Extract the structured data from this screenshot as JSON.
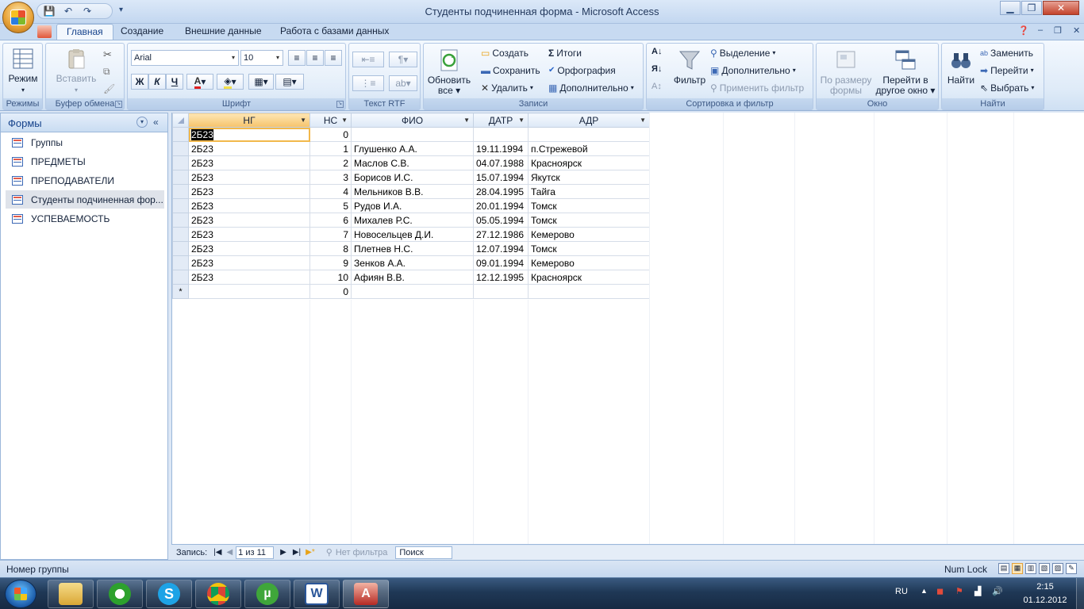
{
  "window": {
    "title": "Студенты подчиненная форма - Microsoft Access"
  },
  "tabs": [
    "Главная",
    "Создание",
    "Внешние данные",
    "Работа с базами данных"
  ],
  "ribbon": {
    "groups": [
      "Режимы",
      "Буфер обмена",
      "Шрифт",
      "Текст RTF",
      "Записи",
      "Сортировка и фильтр",
      "Окно",
      "Найти"
    ],
    "mode_label": "Режим",
    "paste_label": "Вставить",
    "font_name": "Arial",
    "font_size": "10",
    "bold": "Ж",
    "italic": "К",
    "underline": "Ч",
    "refresh_label_1": "Обновить",
    "refresh_label_2": "все",
    "records": {
      "create": "Создать",
      "save": "Сохранить",
      "delete": "Удалить",
      "totals": "Итоги",
      "spelling": "Орфография",
      "more": "Дополнительно"
    },
    "filter": {
      "filter": "Фильтр",
      "selection": "Выделение",
      "advanced": "Дополнительно",
      "apply": "Применить фильтр"
    },
    "window": {
      "fit_1": "По размеру",
      "fit_2": "формы",
      "switch_1": "Перейти в",
      "switch_2": "другое окно"
    },
    "find": {
      "find": "Найти",
      "replace": "Заменить",
      "goto": "Перейти",
      "select": "Выбрать"
    }
  },
  "nav": {
    "title": "Формы",
    "items": [
      "Группы",
      "ПРЕДМЕТЫ",
      "ПРЕПОДАВАТЕЛИ",
      "Студенты подчиненная фор...",
      "УСПЕВАЕМОСТЬ"
    ]
  },
  "grid": {
    "columns": [
      "НГ",
      "НС",
      "ФИО",
      "ДАТР",
      "АДР"
    ],
    "rows": [
      [
        "2Б23",
        "0",
        "",
        "",
        ""
      ],
      [
        "2Б23",
        "1",
        "Глушенко А.А.",
        "19.11.1994",
        "п.Стрежевой"
      ],
      [
        "2Б23",
        "2",
        "Маслов С.В.",
        "04.07.1988",
        "Красноярск"
      ],
      [
        "2Б23",
        "3",
        "Борисов И.С.",
        "15.07.1994",
        "Якутск"
      ],
      [
        "2Б23",
        "4",
        "Мельников В.В.",
        "28.04.1995",
        "Тайга"
      ],
      [
        "2Б23",
        "5",
        "Рудов И.А.",
        "20.01.1994",
        "Томск"
      ],
      [
        "2Б23",
        "6",
        "Михалев Р.С.",
        "05.05.1994",
        "Томск"
      ],
      [
        "2Б23",
        "7",
        "Новосельцев Д.И.",
        "27.12.1986",
        "Кемерово"
      ],
      [
        "2Б23",
        "8",
        "Плетнев Н.С.",
        "12.07.1994",
        "Томск"
      ],
      [
        "2Б23",
        "9",
        "Зенков А.А.",
        "09.01.1994",
        "Кемерово"
      ],
      [
        "2Б23",
        "10",
        "Афиян В.В.",
        "12.12.1995",
        "Красноярск"
      ]
    ],
    "new_row": [
      "",
      "0",
      "",
      "",
      ""
    ],
    "new_row_marker": "*"
  },
  "record_nav": {
    "label": "Запись:",
    "position": "1 из 11",
    "filter": "Нет фильтра",
    "search": "Поиск"
  },
  "status": {
    "text": "Номер группы",
    "numlock": "Num Lock"
  },
  "tray": {
    "lang": "RU",
    "time": "2:15",
    "date": "01.12.2012"
  }
}
